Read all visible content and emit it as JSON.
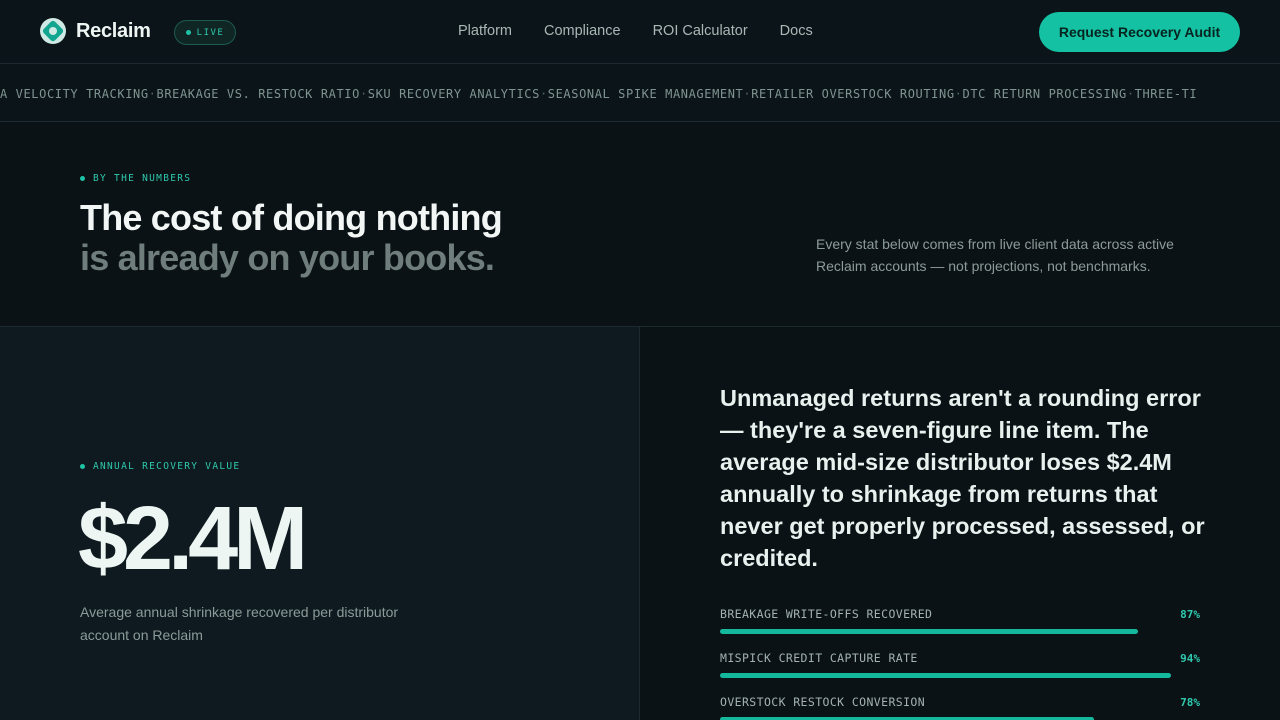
{
  "nav": {
    "brand": "Reclaim",
    "status_badge": "LIVE",
    "links": [
      "Platform",
      "Compliance",
      "ROI Calculator",
      "Docs"
    ],
    "cta": "Request Recovery Audit"
  },
  "ticker": {
    "items": [
      "A VELOCITY TRACKING",
      "BREAKAGE VS. RESTOCK RATIO",
      "SKU RECOVERY ANALYTICS",
      "SEASONAL SPIKE MANAGEMENT",
      "RETAILER OVERSTOCK ROUTING",
      "DTC RETURN PROCESSING",
      "THREE-TI"
    ],
    "separator": "·"
  },
  "hero": {
    "eyebrow": "BY THE NUMBERS",
    "title_line1": "The cost of doing nothing",
    "title_line2": "is already on your books.",
    "description": "Every stat below comes from live client data across active Reclaim accounts — not projections, not benchmarks."
  },
  "stat": {
    "eyebrow": "ANNUAL RECOVERY VALUE",
    "value": "$2.4M",
    "caption": "Average annual shrinkage recovered per distributor account on Reclaim"
  },
  "statement": "Unmanaged returns aren't a rounding error — they're a seven-figure line item. The average mid-size distributor loses $2.4M annually to shrinkage from returns that never get properly processed, assessed, or credited.",
  "metrics": [
    {
      "label": "BREAKAGE WRITE-OFFS RECOVERED",
      "value": "87%",
      "percent": 87
    },
    {
      "label": "MISPICK CREDIT CAPTURE RATE",
      "value": "94%",
      "percent": 94
    },
    {
      "label": "OVERSTOCK RESTOCK CONVERSION",
      "value": "78%",
      "percent": 78
    }
  ],
  "colors": {
    "accent": "#14c2a3",
    "background": "#0b1317",
    "panel": "#0e1a1f"
  },
  "icons": {
    "logo": "reclaim-logo-icon",
    "status": "live-dot-icon"
  }
}
